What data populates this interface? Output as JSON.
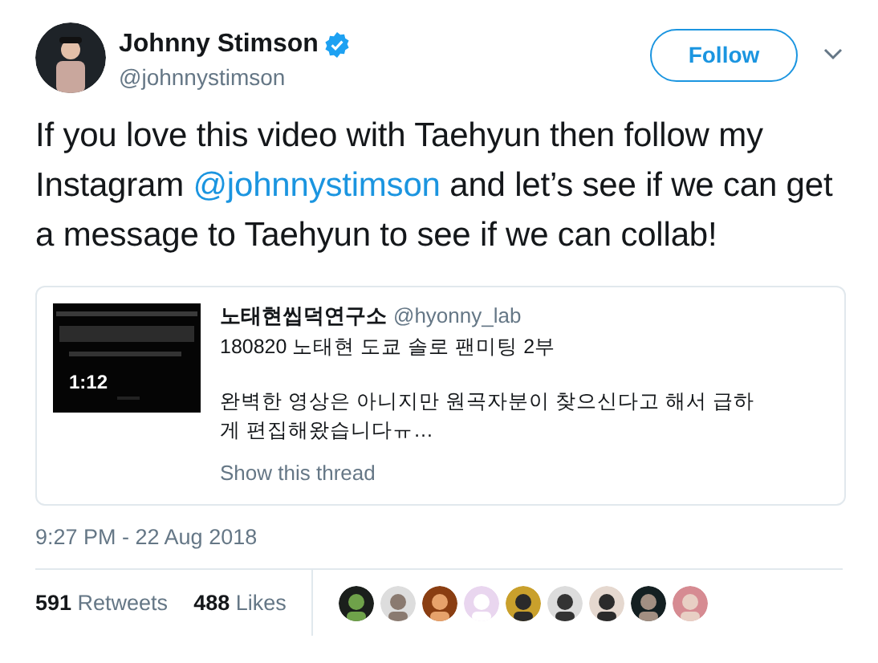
{
  "author": {
    "name": "Johnny Stimson",
    "verified": true,
    "handle": "@johnnystimson"
  },
  "follow_button": {
    "label": "Follow"
  },
  "tweet_text": [
    {
      "kind": "text",
      "text": "If you love this video with Taehyun then follow my Instagram "
    },
    {
      "kind": "link",
      "text": "@johnnystimson"
    },
    {
      "kind": "text",
      "text": " and let’s see if we can get a message to Taehyun to see if we can collab!"
    }
  ],
  "quoted_tweet": {
    "thumbnail": {
      "kind": "picture",
      "duration": "1:12"
    },
    "name": "노태현씹덕연구소",
    "handle": "@hyonny_lab",
    "title": "180820 노태현 도쿄 솔로 팬미팅 2부",
    "body": "완벽한 영상은 아니지만 원곡자분이 찾으신다고 해서 급하게 편집해왔습니다ㅠ…",
    "show_thread": "Show this thread"
  },
  "timestamp": "9:27 PM - 22 Aug 2018",
  "stats": [
    {
      "count": "591",
      "label": "Retweets"
    },
    {
      "count": "488",
      "label": "Likes"
    }
  ]
}
